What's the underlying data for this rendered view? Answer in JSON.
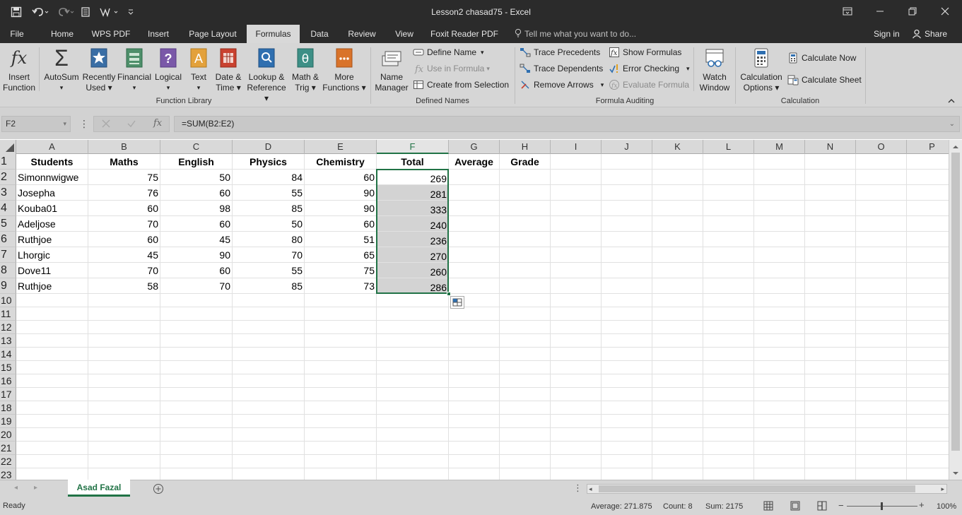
{
  "window": {
    "title": "Lesson2 chasad75 - Excel"
  },
  "tabs": [
    "File",
    "Home",
    "WPS PDF",
    "Insert",
    "Page Layout",
    "Formulas",
    "Data",
    "Review",
    "View",
    "Foxit Reader PDF"
  ],
  "active_tab": "Formulas",
  "tell_me": "Tell me what you want to do...",
  "sign_in": "Sign in",
  "share": "Share",
  "ribbon": {
    "function_library": {
      "label": "Function Library",
      "buttons": [
        {
          "l1": "Insert",
          "l2": "Function",
          "icon": "fx-icon"
        },
        {
          "l1": "AutoSum",
          "l2": "▾",
          "icon": "sigma-icon"
        },
        {
          "l1": "Recently",
          "l2": "Used ▾",
          "icon": "star-book-icon"
        },
        {
          "l1": "Financial",
          "l2": "▾",
          "icon": "financial-book-icon"
        },
        {
          "l1": "Logical",
          "l2": "▾",
          "icon": "question-book-icon"
        },
        {
          "l1": "Text",
          "l2": "▾",
          "icon": "text-book-icon"
        },
        {
          "l1": "Date &",
          "l2": "Time ▾",
          "icon": "calendar-book-icon"
        },
        {
          "l1": "Lookup &",
          "l2": "Reference ▾",
          "icon": "search-book-icon"
        },
        {
          "l1": "Math &",
          "l2": "Trig ▾",
          "icon": "theta-book-icon"
        },
        {
          "l1": "More",
          "l2": "Functions ▾",
          "icon": "more-book-icon"
        }
      ]
    },
    "defined_names": {
      "label": "Defined Names",
      "name_manager": {
        "l1": "Name",
        "l2": "Manager"
      },
      "define_name": "Define Name",
      "use_in_formula": "Use in Formula",
      "create_from_selection": "Create from Selection"
    },
    "formula_auditing": {
      "label": "Formula Auditing",
      "trace_precedents": "Trace Precedents",
      "trace_dependents": "Trace Dependents",
      "remove_arrows": "Remove Arrows",
      "show_formulas": "Show Formulas",
      "error_checking": "Error Checking",
      "evaluate_formula": "Evaluate Formula",
      "watch_window": {
        "l1": "Watch",
        "l2": "Window"
      }
    },
    "calculation": {
      "label": "Calculation",
      "options": {
        "l1": "Calculation",
        "l2": "Options ▾"
      },
      "calculate_now": "Calculate Now",
      "calculate_sheet": "Calculate Sheet"
    }
  },
  "formula_bar": {
    "name_box": "F2",
    "formula": "=SUM(B2:E2)"
  },
  "sheet": {
    "columns": [
      "A",
      "B",
      "C",
      "D",
      "E",
      "F",
      "G",
      "H",
      "I",
      "J",
      "K",
      "L",
      "M",
      "N",
      "O",
      "P"
    ],
    "rows": [
      "1",
      "2",
      "3",
      "4",
      "5",
      "6",
      "7",
      "8",
      "9",
      "10",
      "11",
      "12",
      "13",
      "14",
      "15",
      "16",
      "17",
      "18",
      "19",
      "20",
      "21",
      "22",
      "23"
    ],
    "headers": [
      "Students",
      "Maths",
      "English",
      "Physics",
      "Chemistry",
      "Total",
      "Average",
      "Grade"
    ],
    "data": [
      [
        "Simonnwigwe",
        "75",
        "50",
        "84",
        "60",
        "269"
      ],
      [
        "Josepha",
        "76",
        "60",
        "55",
        "90",
        "281"
      ],
      [
        "Kouba01",
        "60",
        "98",
        "85",
        "90",
        "333"
      ],
      [
        "Adeljose",
        "70",
        "60",
        "50",
        "60",
        "240"
      ],
      [
        "Ruthjoe",
        "60",
        "45",
        "80",
        "51",
        "236"
      ],
      [
        "Lhorgic",
        "45",
        "90",
        "70",
        "65",
        "270"
      ],
      [
        "Dove11",
        "70",
        "60",
        "55",
        "75",
        "260"
      ],
      [
        "Ruthjoe",
        "58",
        "70",
        "85",
        "73",
        "286"
      ]
    ]
  },
  "sheet_tab": "Asad Fazal",
  "status": {
    "ready": "Ready",
    "average": "Average: 271.875",
    "count": "Count: 8",
    "sum": "Sum: 2175",
    "zoom": "100%"
  },
  "colors": {
    "accent": "#217346",
    "title_bar": "#2b2b2b",
    "ribbon": "#d6d6d6"
  }
}
